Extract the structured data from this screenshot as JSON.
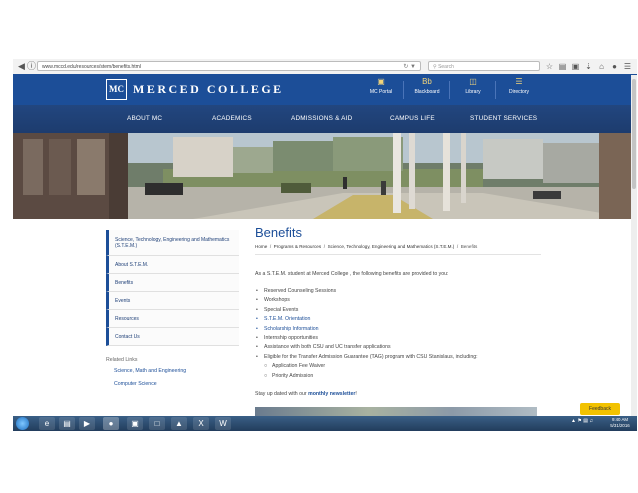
{
  "browser": {
    "url": "www.mccd.edu/resources/stem/benefits.html",
    "search_placeholder": "Search",
    "back_icon": "back-arrow-icon",
    "forward_icon": "forward-arrow-icon",
    "toolbar_icons": [
      "star-icon",
      "reading-list-icon",
      "pocket-icon",
      "download-icon",
      "home-icon",
      "sync-icon",
      "menu-icon"
    ]
  },
  "header": {
    "logo_mark": "MC",
    "college_name": "MERCED COLLEGE",
    "utility": [
      {
        "label": "MC Portal",
        "icon": "building-icon"
      },
      {
        "label": "Blackboard",
        "icon": "blackboard-icon"
      },
      {
        "label": "Library",
        "icon": "library-icon"
      },
      {
        "label": "Directory",
        "icon": "directory-icon"
      }
    ]
  },
  "nav": [
    "ABOUT MC",
    "ACADEMICS",
    "ADMISSIONS & AID",
    "CAMPUS LIFE",
    "STUDENT SERVICES"
  ],
  "sidebar": {
    "items": [
      "Science, Technology, Engineering and Mathematics (S.T.E.M.)",
      "About S.T.E.M.",
      "Benefits",
      "Events",
      "Resources",
      "Contact Us"
    ],
    "related_title": "Related Links",
    "related_links": [
      "Science, Math and Engineering",
      "Computer Science"
    ]
  },
  "content": {
    "title": "Benefits",
    "breadcrumb": [
      "Home",
      "Programs & Resources",
      "Science, Technology, Engineering and Mathematics (S.T.E.M.)",
      "Benefits"
    ],
    "intro": "As a S.T.E.M. student at Merced College , the following benefits are provided to you:",
    "benefits": [
      "Reserved Counseling Sessions",
      "Workshops",
      "Special Events",
      "S.T.E.M. Orientation",
      "Scholarship Information",
      "Internship opportunities",
      "Assistance with both CSU and UC transfer applications",
      "Eligible for the Transfer Admission Guarantee (TAG) program with CSU Stanislaus, including:"
    ],
    "sub_benefits": [
      "Application Fee Waiver",
      "Priority Admission"
    ],
    "stay_prefix": "Stay up dated with our",
    "stay_link": "monthly newsletter",
    "stay_suffix": "!"
  },
  "feedback_label": "Feedback",
  "taskbar": {
    "time": "9:40 AM",
    "date": "5/31/2016"
  },
  "colors": {
    "brand_blue": "#1c4e98",
    "nav_blue": "#1d3c6e",
    "feedback_yellow": "#f2c200"
  }
}
